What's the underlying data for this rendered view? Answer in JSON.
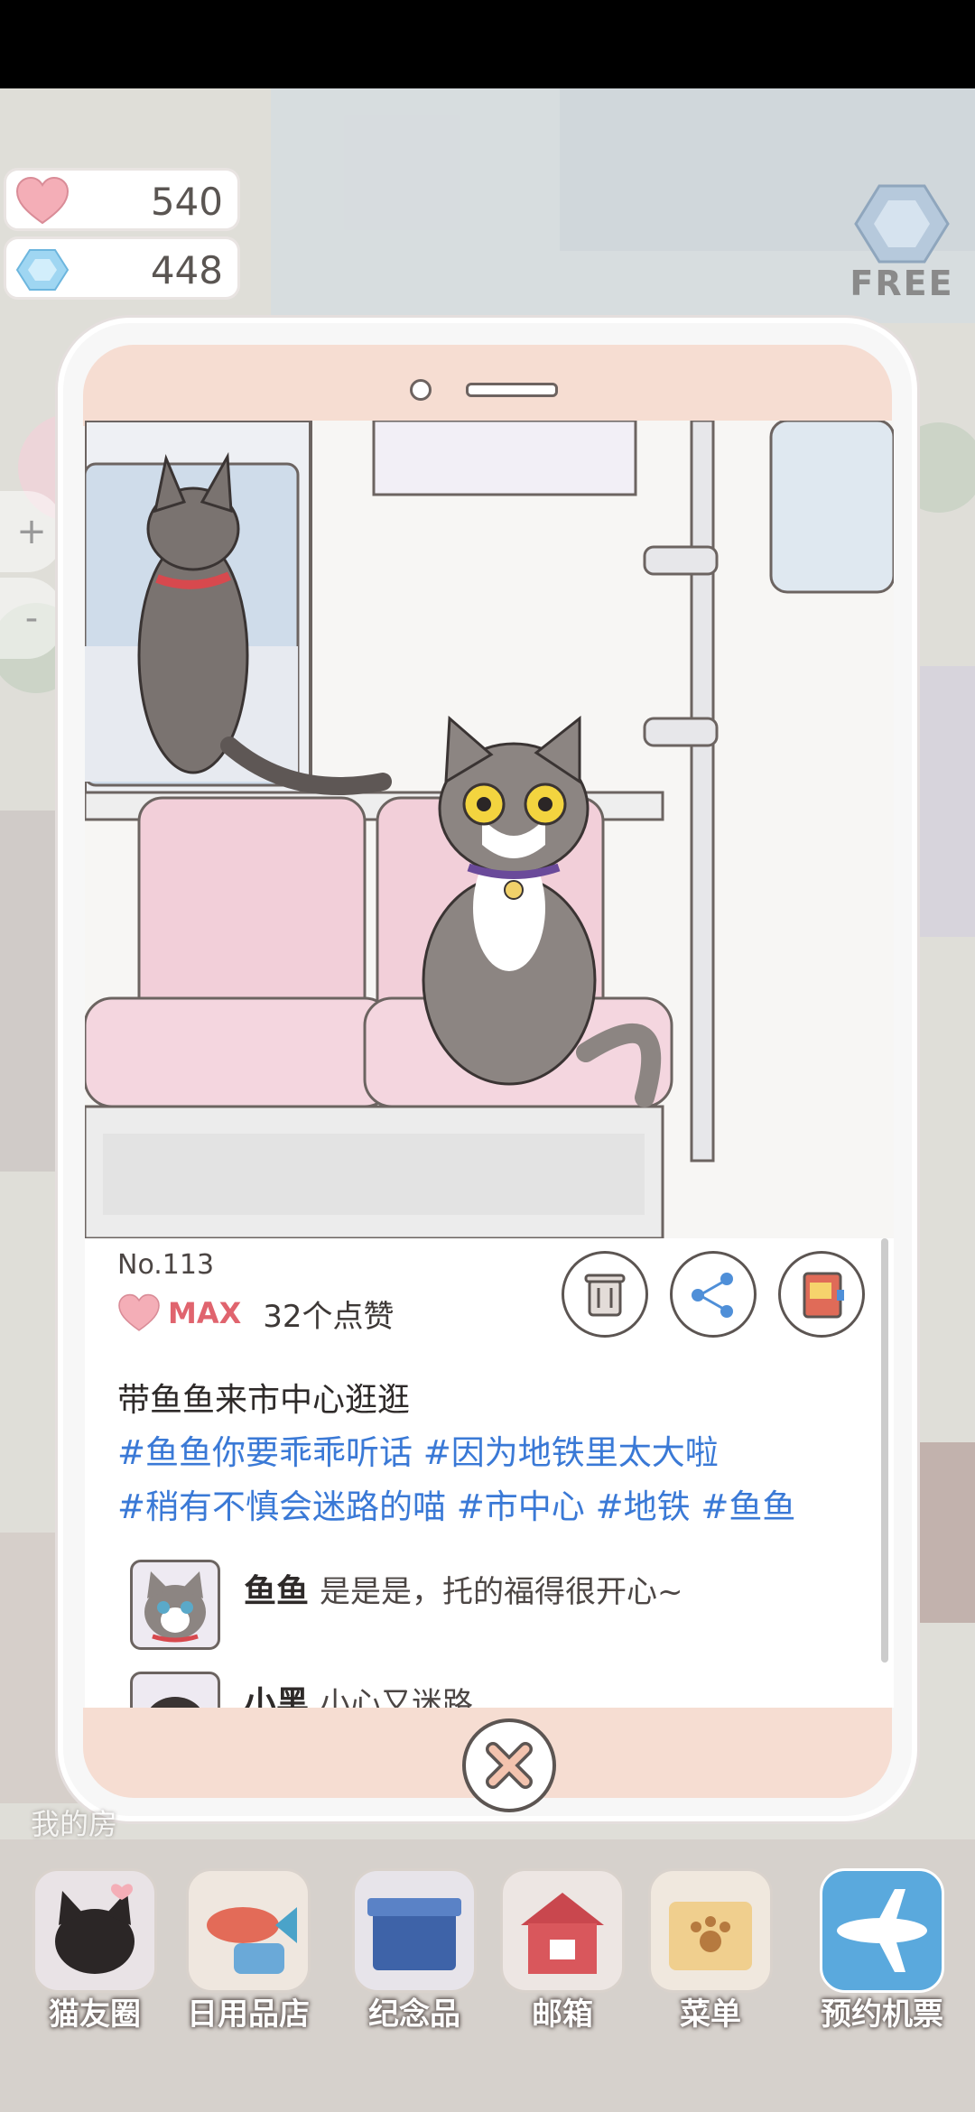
{
  "hud": {
    "hearts": "540",
    "gems": "448",
    "free_label": "FREE",
    "zoom_in": "+",
    "zoom_out": "-"
  },
  "post": {
    "number": "No.113",
    "like_level": "MAX",
    "like_count": "32个点赞",
    "caption": "带鱼鱼来市中心逛逛",
    "tags": [
      "#鱼鱼你要乖乖听话",
      "#因为地铁里太大啦",
      "#稍有不慎会迷路的喵",
      "#市中心",
      "#地铁",
      "#鱼鱼"
    ],
    "comments": [
      {
        "name": "鱼鱼",
        "text": "是是是，托的福得很开心~"
      },
      {
        "name": "小黑",
        "text": "小心又迷路"
      }
    ]
  },
  "background_label": "我的房",
  "nav": [
    {
      "label": "猫友圈"
    },
    {
      "label": "日用品店"
    },
    {
      "label": "纪念品"
    },
    {
      "label": "邮箱"
    },
    {
      "label": "菜单"
    },
    {
      "label": "预约机票"
    }
  ],
  "colors": {
    "heart": "#f4aeb7",
    "gem": "#9fd6f2",
    "tag_blue": "#3a79d6",
    "frame_pink": "#f6ddd2",
    "seat_pink": "#f2cfd9"
  }
}
